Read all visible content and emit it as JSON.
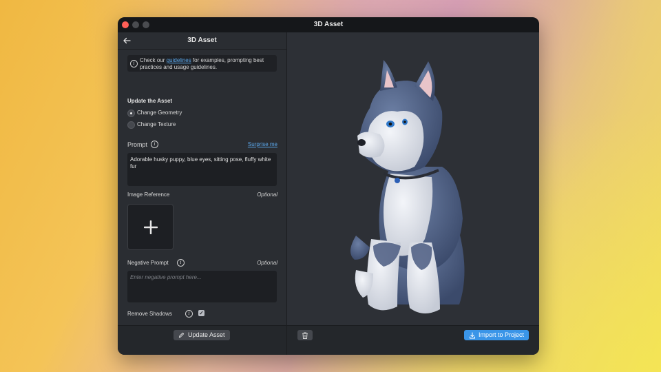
{
  "window": {
    "title": "3D Asset"
  },
  "panel": {
    "title": "3D Asset",
    "info": {
      "prefix": "Check our ",
      "link": "guidelines",
      "suffix": " for examples, prompting best practices and usage guidelines."
    },
    "update_section": {
      "title": "Update the Asset",
      "options": [
        {
          "label": "Change Geometry",
          "selected": true
        },
        {
          "label": "Change Texture",
          "selected": false
        }
      ]
    },
    "prompt": {
      "label": "Prompt",
      "surprise_link": "Surprise me",
      "value": "Adorable husky puppy, blue eyes, sitting pose, fluffy white fur"
    },
    "image_reference": {
      "label": "Image Reference",
      "optional": "Optional"
    },
    "negative_prompt": {
      "label": "Negative Prompt",
      "optional": "Optional",
      "placeholder": "Enter negative prompt here..."
    },
    "remove_shadows": {
      "label": "Remove Shadows",
      "checked": true
    },
    "update_button": "Update Asset"
  },
  "viewer": {
    "import_button": "Import to Project",
    "colors": {
      "accent": "#3a95e8",
      "background": "#2d3036",
      "fur_blue": "#4e6185",
      "fur_white": "#e6e9ef"
    }
  }
}
